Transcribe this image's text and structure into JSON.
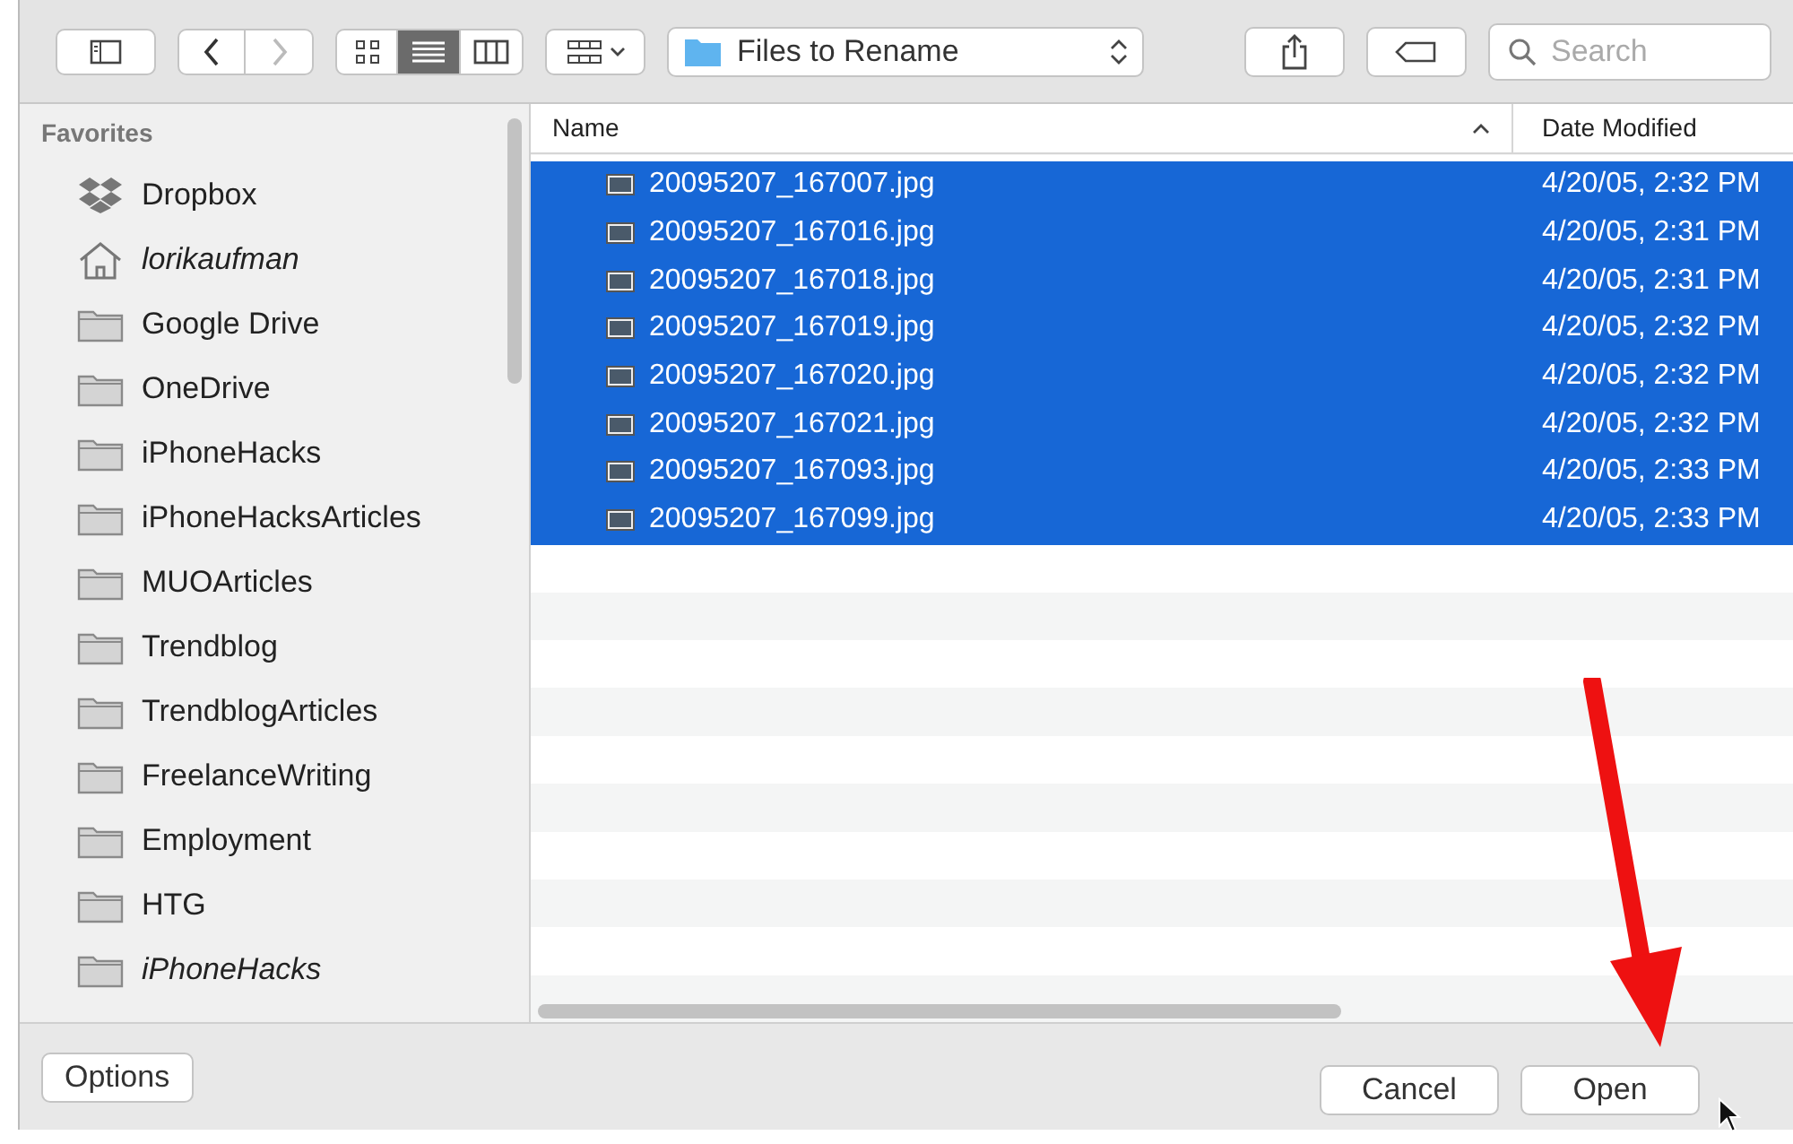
{
  "toolbar": {
    "view_modes": [
      {
        "kind": "icons",
        "selected": false
      },
      {
        "kind": "list",
        "selected": true
      },
      {
        "kind": "columns",
        "selected": false
      }
    ],
    "location": "Files to Rename",
    "search": {
      "placeholder": "Search"
    }
  },
  "sidebar": {
    "heading": "Favorites",
    "items": [
      {
        "label": "Dropbox",
        "kind": "dropbox",
        "italic": false
      },
      {
        "label": "lorikaufman",
        "kind": "home",
        "italic": true
      },
      {
        "label": "Google Drive",
        "kind": "folder",
        "italic": false
      },
      {
        "label": "OneDrive",
        "kind": "folder",
        "italic": false
      },
      {
        "label": "iPhoneHacks",
        "kind": "folder",
        "italic": false
      },
      {
        "label": "iPhoneHacksArticles",
        "kind": "folder",
        "italic": false
      },
      {
        "label": "MUOArticles",
        "kind": "folder",
        "italic": false
      },
      {
        "label": "Trendblog",
        "kind": "folder",
        "italic": false
      },
      {
        "label": "TrendblogArticles",
        "kind": "folder",
        "italic": false
      },
      {
        "label": "FreelanceWriting",
        "kind": "folder",
        "italic": false
      },
      {
        "label": "Employment",
        "kind": "folder",
        "italic": false
      },
      {
        "label": "HTG",
        "kind": "folder",
        "italic": false
      },
      {
        "label": "iPhoneHacks",
        "kind": "folder",
        "italic": true
      }
    ]
  },
  "table": {
    "columns": [
      "Name",
      "Date Modified"
    ],
    "rows": [
      {
        "name": "20095207_167007.jpg",
        "date": "4/20/05, 2:32 PM",
        "selected": true
      },
      {
        "name": "20095207_167016.jpg",
        "date": "4/20/05, 2:31 PM",
        "selected": true
      },
      {
        "name": "20095207_167018.jpg",
        "date": "4/20/05, 2:31 PM",
        "selected": true
      },
      {
        "name": "20095207_167019.jpg",
        "date": "4/20/05, 2:32 PM",
        "selected": true
      },
      {
        "name": "20095207_167020.jpg",
        "date": "4/20/05, 2:32 PM",
        "selected": true
      },
      {
        "name": "20095207_167021.jpg",
        "date": "4/20/05, 2:32 PM",
        "selected": true
      },
      {
        "name": "20095207_167093.jpg",
        "date": "4/20/05, 2:33 PM",
        "selected": true
      },
      {
        "name": "20095207_167099.jpg",
        "date": "4/20/05, 2:33 PM",
        "selected": true
      }
    ]
  },
  "buttons": {
    "options": "Options",
    "cancel": "Cancel",
    "open": "Open"
  }
}
